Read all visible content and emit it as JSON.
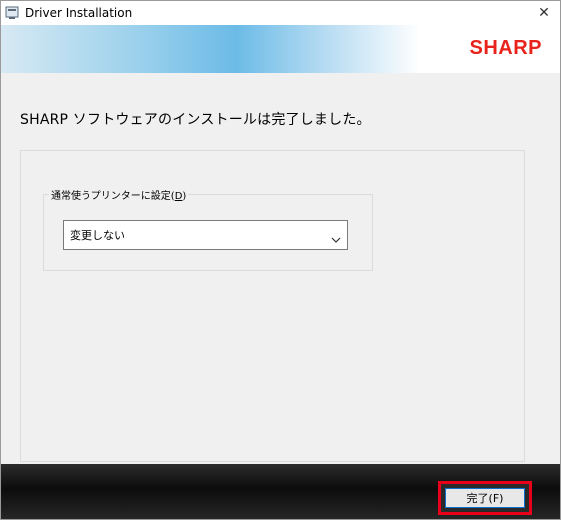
{
  "window": {
    "title": "Driver Installation",
    "close_glyph": "✕",
    "icon": "installer-icon"
  },
  "banner": {
    "brand": "SHARP",
    "brand_color": "#e8231c"
  },
  "message": "SHARP ソフトウェアのインストールは完了しました。",
  "default_printer": {
    "label_prefix": "通常使うプリンターに設定(",
    "label_mnemonic": "D",
    "label_suffix": ")",
    "selected": "変更しない"
  },
  "footer": {
    "finish_label": "完了(F)",
    "highlight_color": "#e8001a"
  }
}
